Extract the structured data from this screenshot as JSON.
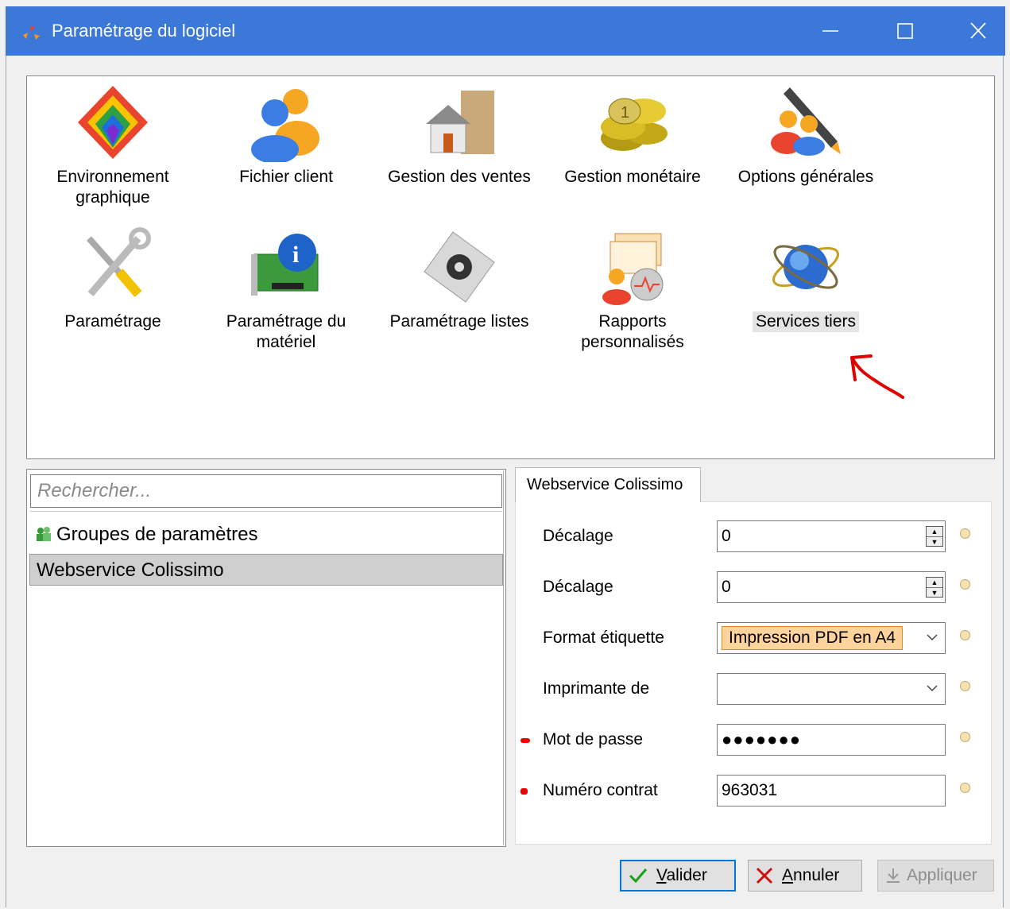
{
  "window": {
    "title": "Paramétrage du logiciel",
    "controls": {
      "minimize": "—",
      "maximize": "☐",
      "close": "✕"
    }
  },
  "tiles": [
    {
      "label": "Environnement graphique",
      "icon": "colorful-diamond-icon"
    },
    {
      "label": "Fichier client",
      "icon": "users-icon"
    },
    {
      "label": "Gestion des ventes",
      "icon": "house-icon"
    },
    {
      "label": "Gestion monétaire",
      "icon": "coins-icon"
    },
    {
      "label": "Options générales",
      "icon": "users-pen-icon"
    },
    {
      "label": "Paramétrage",
      "icon": "tools-icon"
    },
    {
      "label": "Paramétrage du matériel",
      "icon": "hardware-info-icon"
    },
    {
      "label": "Paramétrage listes",
      "icon": "list-gear-icon"
    },
    {
      "label": "Rapports personnalisés",
      "icon": "reports-icon"
    },
    {
      "label": "Services tiers",
      "icon": "globe-icon",
      "selected": true
    }
  ],
  "list": {
    "search_placeholder": "Rechercher...",
    "items": [
      {
        "label": "Groupes de paramètres",
        "icon": "group-icon"
      },
      {
        "label": "Webservice Colissimo",
        "selected": true
      }
    ]
  },
  "tab": {
    "label": "Webservice Colissimo"
  },
  "form": {
    "rows": [
      {
        "label": "Décalage",
        "value": "0",
        "type": "spinner"
      },
      {
        "label": "Décalage",
        "value": "0",
        "type": "spinner"
      },
      {
        "label": "Format étiquette",
        "value": "Impression PDF en A4",
        "type": "select"
      },
      {
        "label": "Imprimante de",
        "value": "",
        "type": "select"
      },
      {
        "label": "Mot de passe",
        "value": "●●●●●●●",
        "type": "password",
        "required": true
      },
      {
        "label": "Numéro contrat",
        "value": "963031",
        "type": "text",
        "required": true
      }
    ]
  },
  "buttons": {
    "validate": "alider",
    "validate_mnemonic": "V",
    "cancel": "nnuler",
    "cancel_mnemonic": "A",
    "apply": "Appliquer"
  },
  "colors": {
    "titlebar": "#3c78d8",
    "accent": "#0078d7",
    "selection_orange": "#ffd39c",
    "required_red": "#e00000",
    "annotation_red": "#e00000"
  }
}
